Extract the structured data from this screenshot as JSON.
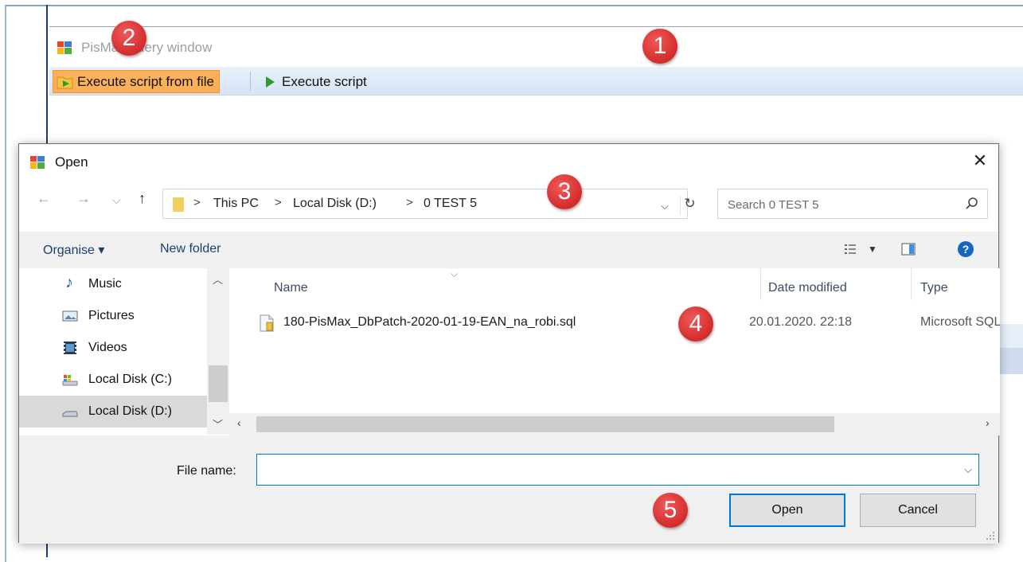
{
  "background_window": {
    "title": "PisMax query window",
    "toolbar": {
      "execute_from_file": "Execute script from file",
      "execute_script": "Execute script"
    }
  },
  "dialog": {
    "title": "Open",
    "close_glyph": "✕",
    "nav": {
      "back": "←",
      "forward": "→",
      "recent": "⌵",
      "up": "↑"
    },
    "breadcrumb": [
      "This PC",
      "Local Disk (D:)",
      "0 TEST 5"
    ],
    "breadcrumb_sep": ">",
    "search_placeholder": "Search 0 TEST 5",
    "commands": {
      "organise": "Organise ▾",
      "new_folder": "New folder"
    },
    "nav_pane": [
      {
        "label": "Music",
        "icon": "music-icon"
      },
      {
        "label": "Pictures",
        "icon": "pictures-icon"
      },
      {
        "label": "Videos",
        "icon": "videos-icon"
      },
      {
        "label": "Local Disk (C:)",
        "icon": "drive-c-icon"
      },
      {
        "label": "Local Disk (D:)",
        "icon": "drive-d-icon",
        "selected": true
      }
    ],
    "columns": [
      "Name",
      "Date modified",
      "Type"
    ],
    "files": [
      {
        "name": "180-PisMax_DbPatch-2020-01-19-EAN_na_robi.sql",
        "date": "20.01.2020. 22:18",
        "type": "Microsoft SQL"
      }
    ],
    "file_name_label": "File name:",
    "file_name_value": "",
    "buttons": {
      "open": "Open",
      "cancel": "Cancel"
    }
  },
  "callouts": [
    "1",
    "2",
    "3",
    "4",
    "5"
  ],
  "colors": {
    "callout": "#d42b2b",
    "toolbar_active": "#fbb05b",
    "accent": "#0078d7"
  }
}
